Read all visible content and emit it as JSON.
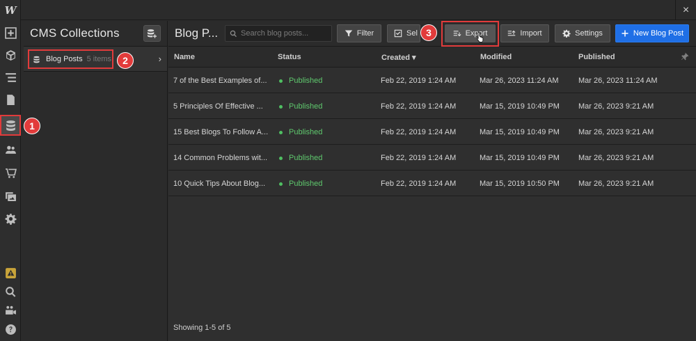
{
  "app": {
    "logo": "W",
    "close_symbol": "×"
  },
  "rail": {
    "items": [
      {
        "icon": "plus-box-icon"
      },
      {
        "icon": "cube-icon"
      },
      {
        "icon": "navigator-lines-icon"
      },
      {
        "icon": "page-icon"
      },
      {
        "icon": "cms-database-icon",
        "active": true
      },
      {
        "icon": "users-icon"
      },
      {
        "icon": "cart-icon"
      },
      {
        "icon": "assets-images-icon"
      },
      {
        "icon": "settings-gear-icon"
      },
      {
        "icon": "warning-icon"
      },
      {
        "icon": "search-icon"
      },
      {
        "icon": "video-people-icon"
      },
      {
        "icon": "help-icon"
      }
    ]
  },
  "collections": {
    "title": "CMS Collections",
    "item_label": "Blog Posts",
    "item_count": "5 items",
    "chevron": "›"
  },
  "main": {
    "title": "Blog P...",
    "search_placeholder": "Search blog posts...",
    "buttons": {
      "filter": "Filter",
      "select": "Sel",
      "export": "Export",
      "import": "Import",
      "settings": "Settings",
      "new": "New Blog Post"
    },
    "columns": {
      "name": "Name",
      "status": "Status",
      "created": "Created ▾",
      "modified": "Modified",
      "published": "Published"
    },
    "rows": [
      {
        "name": "7 of the Best Examples of...",
        "status": "Published",
        "created": "Feb 22, 2019 1:24 AM",
        "modified": "Mar 26, 2023 11:24 AM",
        "published": "Mar 26, 2023 11:24 AM"
      },
      {
        "name": "5 Principles Of Effective ...",
        "status": "Published",
        "created": "Feb 22, 2019 1:24 AM",
        "modified": "Mar 15, 2019 10:49 PM",
        "published": "Mar 26, 2023 9:21 AM"
      },
      {
        "name": "15 Best Blogs To Follow A...",
        "status": "Published",
        "created": "Feb 22, 2019 1:24 AM",
        "modified": "Mar 15, 2019 10:49 PM",
        "published": "Mar 26, 2023 9:21 AM"
      },
      {
        "name": "14 Common Problems wit...",
        "status": "Published",
        "created": "Feb 22, 2019 1:24 AM",
        "modified": "Mar 15, 2019 10:49 PM",
        "published": "Mar 26, 2023 9:21 AM"
      },
      {
        "name": "10 Quick Tips About Blog...",
        "status": "Published",
        "created": "Feb 22, 2019 1:24 AM",
        "modified": "Mar 15, 2019 10:50 PM",
        "published": "Mar 26, 2023 9:21 AM"
      }
    ],
    "footer": "Showing 1-5 of 5"
  },
  "callouts": [
    "1",
    "2",
    "3"
  ],
  "colors": {
    "accent_blue": "#1f6fe6",
    "callout_red": "#e23b3b",
    "status_green": "#5fc96e"
  }
}
